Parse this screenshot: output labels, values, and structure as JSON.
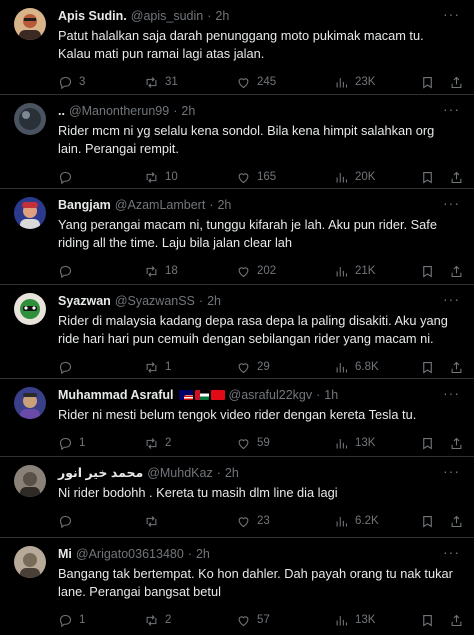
{
  "tweets": [
    {
      "name": "Apis Sudin.",
      "handle": "@apis_sudin",
      "time": "2h",
      "text": "Patut halalkan saja darah penunggang moto pukimak macam tu. Kalau mati pun ramai lagi atas jalan.",
      "replies": "3",
      "retweets": "31",
      "likes": "245",
      "views": "23K",
      "avatar_color": "#b85a3a"
    },
    {
      "name": "..",
      "handle": "@Manontherun99",
      "time": "2h",
      "text": "Rider mcm ni yg selalu kena sondol. Bila kena himpit salahkan org lain. Perangai rempit.",
      "replies": "",
      "retweets": "10",
      "likes": "165",
      "views": "20K",
      "avatar_color": "#3a4450"
    },
    {
      "name": "Bangjam",
      "handle": "@AzamLambert",
      "time": "2h",
      "text": "Yang perangai macam ni, tunggu kifarah je lah. Aku pun rider. Safe riding all the time. Laju bila jalan clear lah",
      "replies": "",
      "retweets": "18",
      "likes": "202",
      "views": "21K",
      "avatar_color": "#c2303a"
    },
    {
      "name": "Syazwan",
      "handle": "@SyazwanSS",
      "time": "2h",
      "text": "Rider di malaysia kadang depa rasa depa la paling disakiti. Aku yang ride hari hari pun cemuih dengan sebilangan rider yang macam ni.",
      "replies": "",
      "retweets": "1",
      "likes": "29",
      "views": "6.8K",
      "avatar_color": "#2f8f3a"
    },
    {
      "name": "Muhammad Asraful",
      "handle": "@asraful22kgv",
      "time": "1h",
      "text": "Rider ni mesti belum tengok video rider  dengan kereta Tesla tu.",
      "replies": "1",
      "retweets": "2",
      "likes": "59",
      "views": "13K",
      "avatar_color": "#6a4aa8"
    },
    {
      "name": "محمد خير انور",
      "handle": "@MuhdKaz",
      "time": "2h",
      "text": "Ni rider bodohh . Kereta tu masih dlm line dia lagi",
      "replies": "",
      "retweets": "",
      "likes": "23",
      "views": "6.2K",
      "avatar_color": "#5a5048"
    },
    {
      "name": "Mi",
      "handle": "@Arigato03613480",
      "time": "2h",
      "text": "Bangang tak bertempat. Ko hon dahler. Dah payah orang tu nak tukar lane. Perangai bangsat betul",
      "replies": "1",
      "retweets": "2",
      "likes": "57",
      "views": "13K",
      "avatar_color": "#7a6a58"
    }
  ],
  "icons": {
    "reply": "reply-icon",
    "retweet": "retweet-icon",
    "like": "heart-icon",
    "views": "views-icon",
    "bookmark": "bookmark-icon",
    "share": "share-icon",
    "more": "more-icon"
  }
}
